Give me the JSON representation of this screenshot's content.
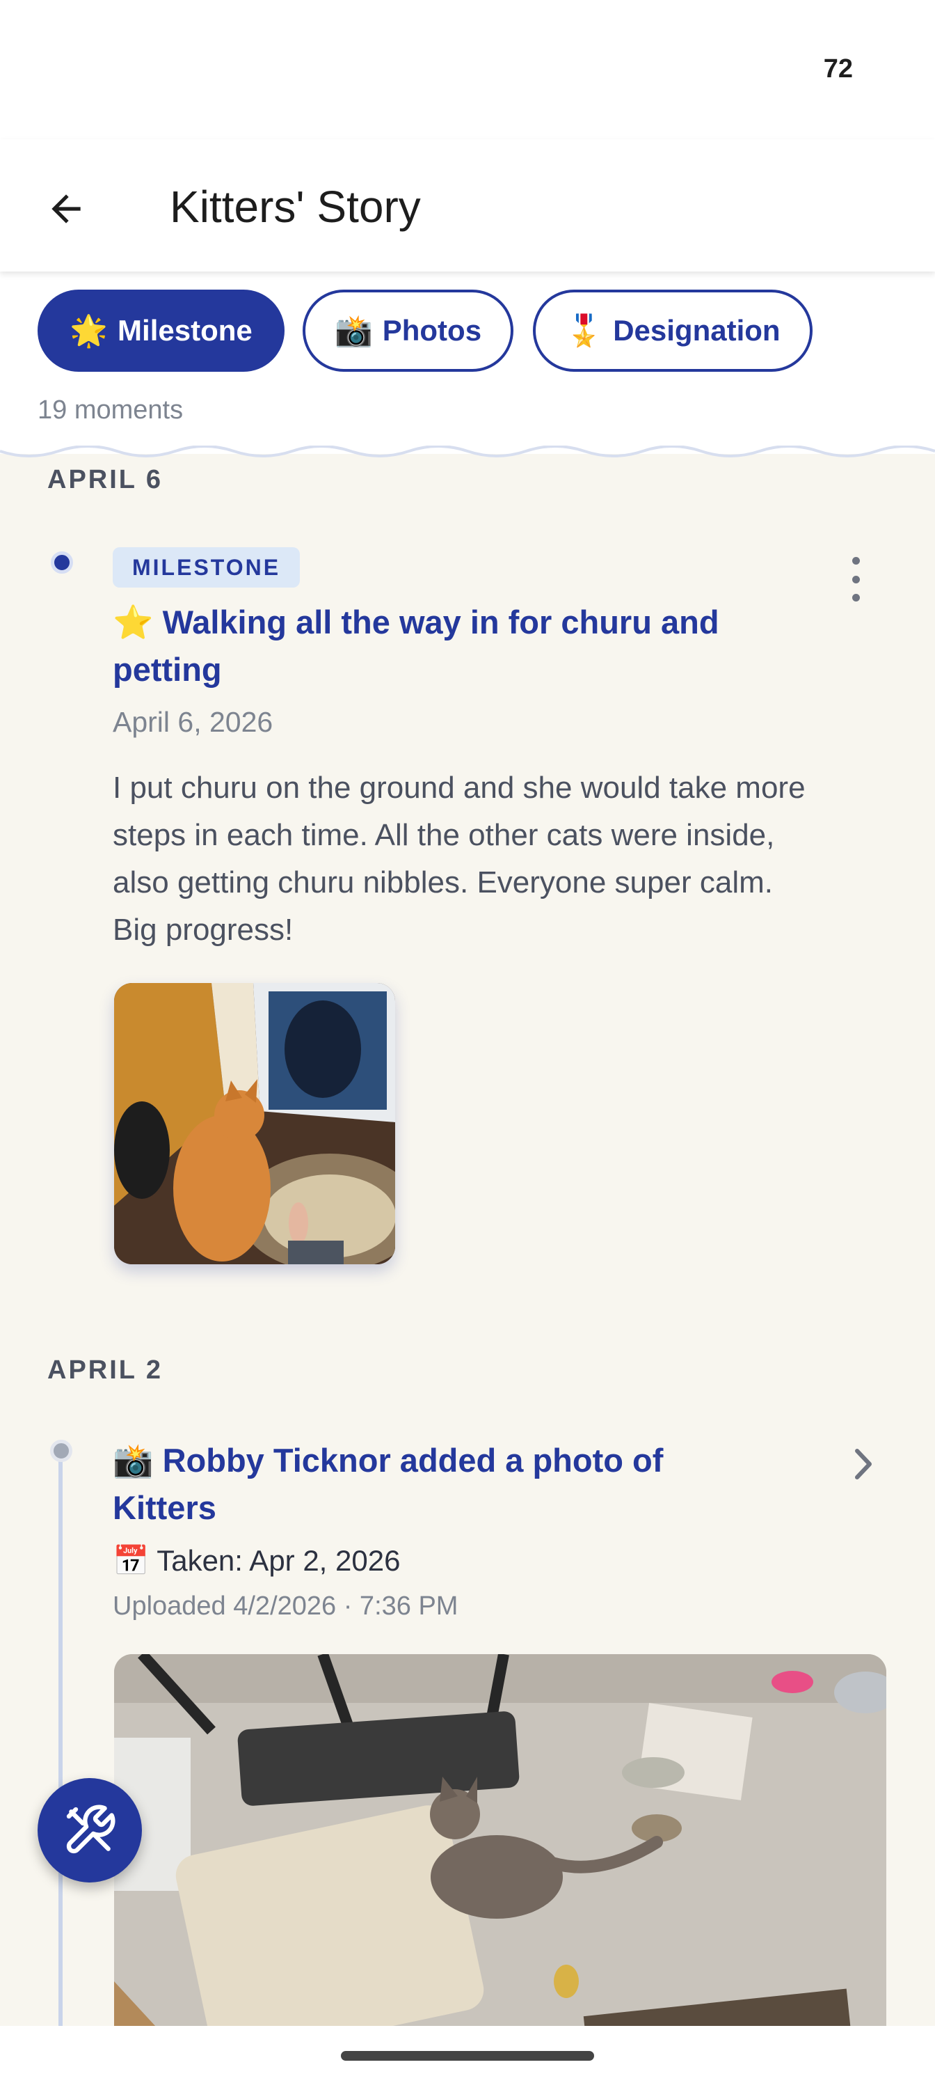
{
  "status_bar": {
    "battery": "72"
  },
  "app_bar": {
    "title": "Kitters' Story",
    "back_icon": "arrow-left-icon"
  },
  "filters": {
    "chips": [
      {
        "emoji": "🌟",
        "label": "Milestone",
        "active": true
      },
      {
        "emoji": "📸",
        "label": "Photos",
        "active": false
      },
      {
        "emoji": "🎖️",
        "label": "Designation",
        "active": false
      }
    ],
    "count_text": "19 moments"
  },
  "timeline": [
    {
      "date_header": "APRIL 6",
      "badge": "MILESTONE",
      "title": "⭐ Walking all the way in for churu and petting",
      "date": "April 6, 2026",
      "body": "I put churu on the ground and she would take more steps in each time. All the other cats were inside, also getting churu nibbles. Everyone super calm. Big progress!",
      "photo": "orange tabby cat sitting at an open sliding door beside a round cat bed"
    },
    {
      "date_header": "APRIL 2",
      "title": "📸 Robby Ticknor added a photo of Kitters",
      "taken": "📅 Taken: Apr 2, 2026",
      "uploaded": "Uploaded 4/2/2026 · 7:36 PM",
      "photo": "gray cat standing on a concrete patio near a cooler and food bowls"
    }
  ],
  "fab": {
    "icon": "tools-icon"
  },
  "colors": {
    "primary": "#24389c",
    "background": "#f8f6ef",
    "badge_bg": "#dce8f7",
    "muted_text": "#7d8490"
  }
}
